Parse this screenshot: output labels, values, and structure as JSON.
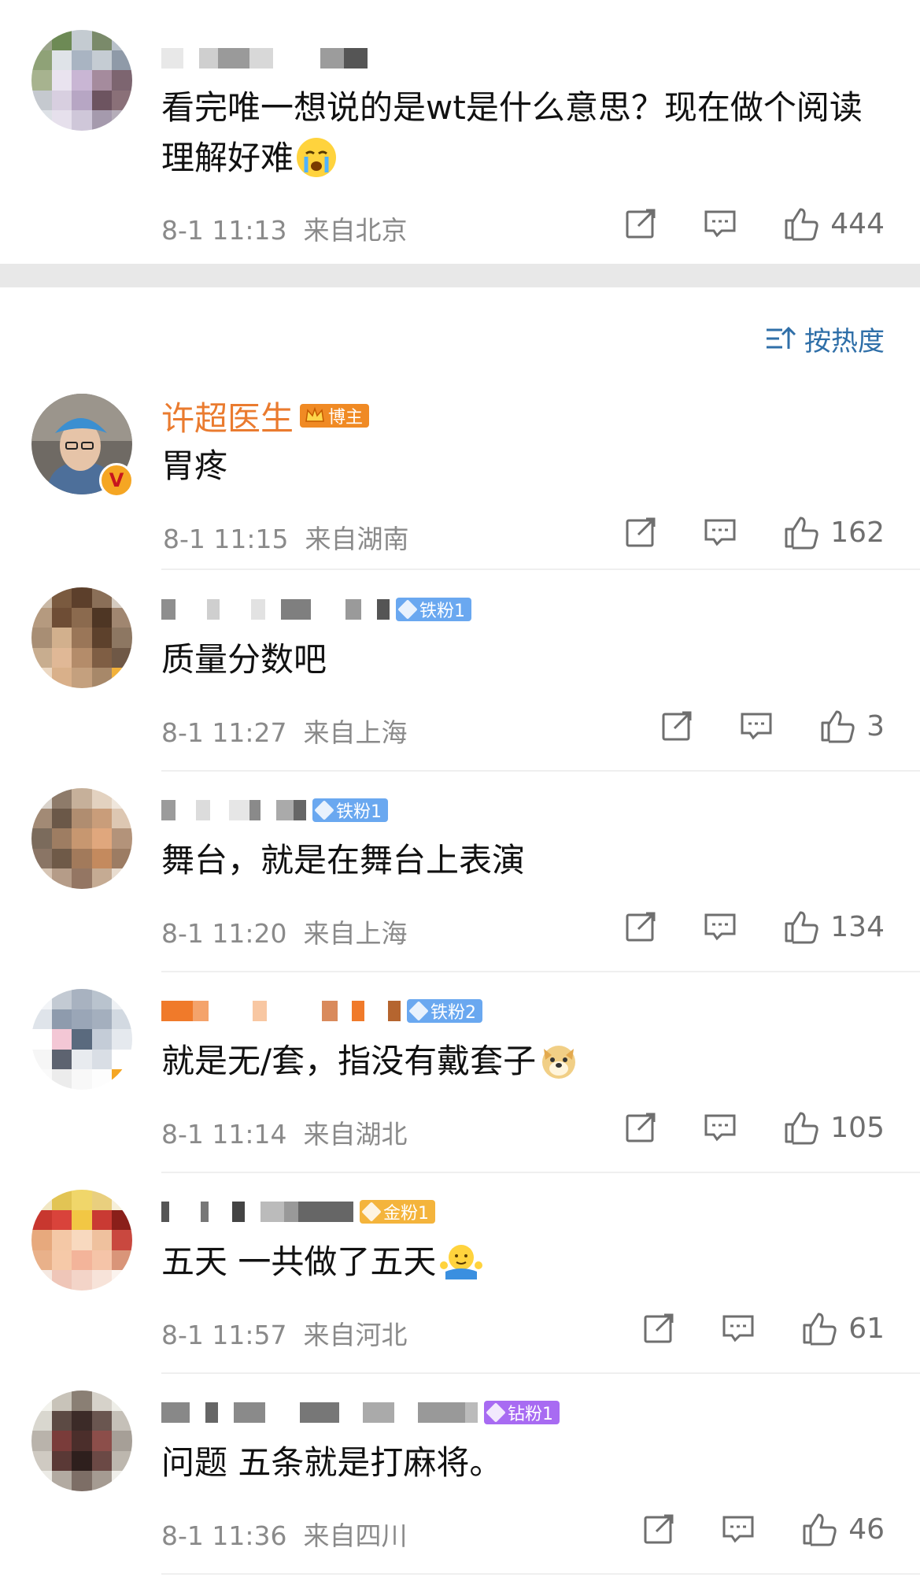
{
  "top_comment": {
    "text": "看完唯一想说的是wt是什么意思？现在做个阅读理解好难",
    "time": "8-1 11:13",
    "location": "来自北京",
    "likes": "444"
  },
  "sort": {
    "label": "按热度"
  },
  "comments": [
    {
      "name": "许超医生",
      "badge": "博主",
      "text": "胃疼",
      "time": "8-1 11:15",
      "location": "来自湖南",
      "likes": "162"
    },
    {
      "badge": "铁粉1",
      "text": "质量分数吧",
      "time": "8-1 11:27",
      "location": "来自上海",
      "likes": "3"
    },
    {
      "badge": "铁粉1",
      "text": "舞台，就是在舞台上表演",
      "time": "8-1 11:20",
      "location": "来自上海",
      "likes": "134"
    },
    {
      "badge": "铁粉2",
      "text": "就是无/套，指没有戴套子",
      "time": "8-1 11:14",
      "location": "来自湖北",
      "likes": "105"
    },
    {
      "badge": "金粉1",
      "text": "五天 一共做了五天",
      "time": "8-1 11:57",
      "location": "来自河北",
      "likes": "61"
    },
    {
      "badge": "钻粉1",
      "text": "问题 五条就是打麻将。",
      "time": "8-1 11:36",
      "location": "来自四川",
      "likes": "46"
    }
  ],
  "colors": {
    "accent_blue": "#2f6fa8",
    "doctor_name": "#ea7b2f",
    "badge_iron": "#6aa8f0",
    "badge_gold": "#f4b43c",
    "badge_diamond": "#a86bf2",
    "badge_host": "#f08a24"
  },
  "icons": [
    "share-icon",
    "comment-icon",
    "like-icon",
    "sort-icon",
    "crying-emoji",
    "doge-emoji",
    "shrug-emoji"
  ]
}
